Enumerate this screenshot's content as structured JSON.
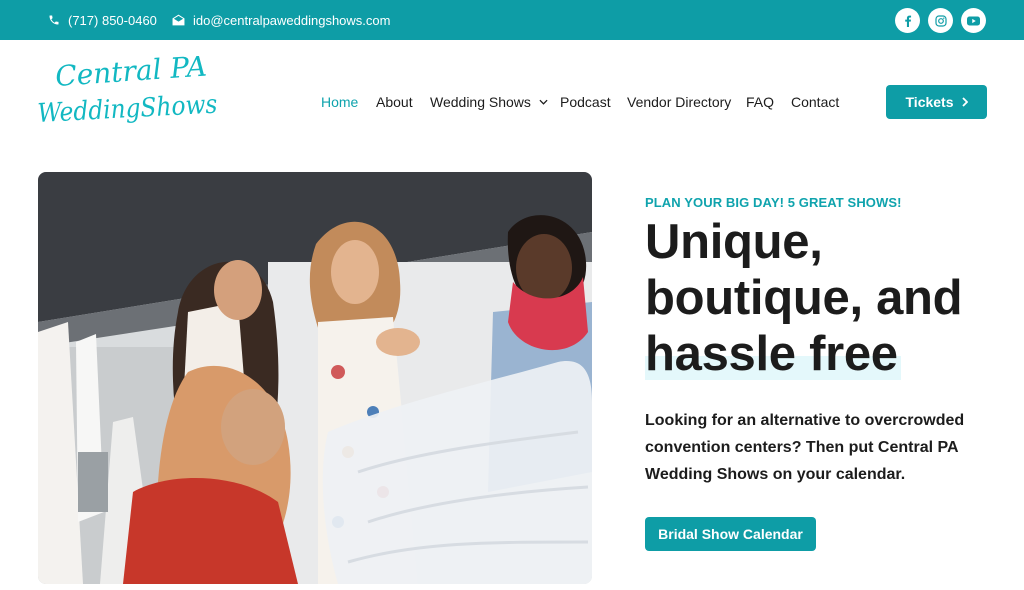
{
  "topbar": {
    "phone": "(717) 850-0460",
    "email": "ido@centralpaweddingshows.com",
    "social": [
      "facebook-icon",
      "instagram-icon",
      "youtube-icon"
    ]
  },
  "header": {
    "logo_line1": "Central PA",
    "logo_line2": "WeddingShows",
    "nav": {
      "home": "Home",
      "about": "About",
      "wedding_shows": "Wedding Shows",
      "podcast": "Podcast",
      "vendor_directory": "Vendor Directory",
      "faq": "FAQ",
      "contact": "Contact"
    },
    "tickets_label": "Tickets"
  },
  "hero": {
    "eyebrow": "PLAN YOUR BIG DAY! 5 GREAT SHOWS!",
    "headline_line1": "Unique,",
    "headline_line2": "boutique, and",
    "headline_line3": "hassle free",
    "lead": "Looking for an alternative to overcrowded convention centers? Then put Central PA Wedding Shows on your calendar.",
    "cta_label": "Bridal Show Calendar"
  },
  "colors": {
    "brand": "#0e9da6",
    "accent_text": "#0fa3ad",
    "highlight": "#e4f8fb",
    "text": "#1c1c1c"
  }
}
